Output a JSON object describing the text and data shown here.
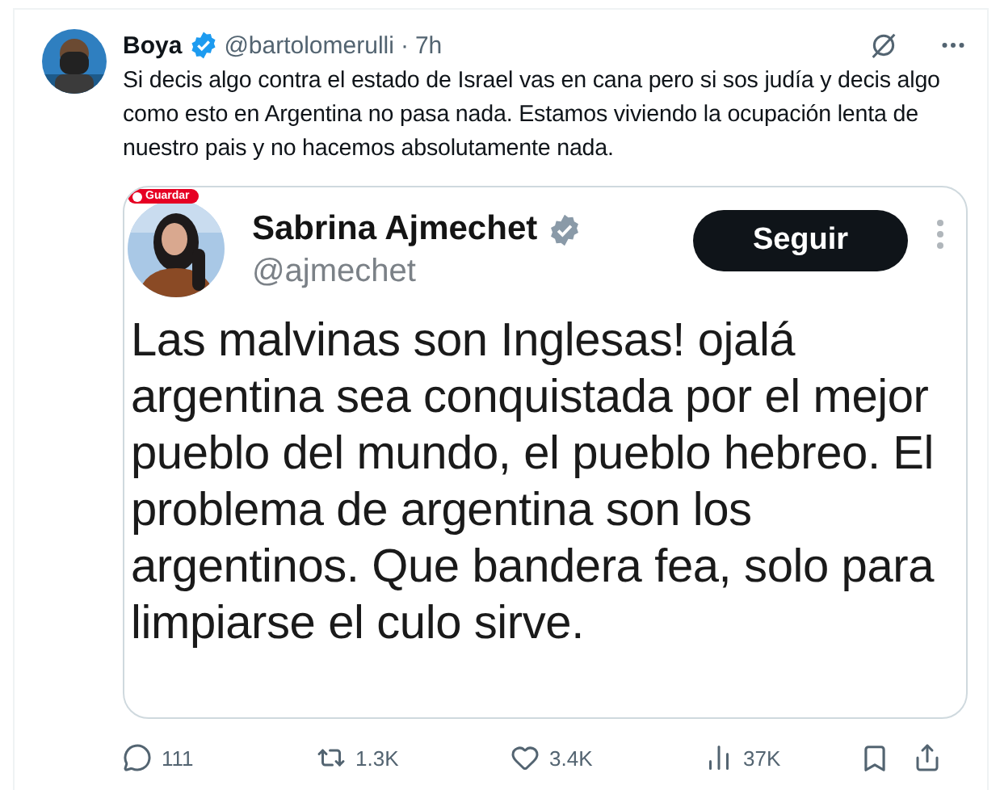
{
  "tweet": {
    "author": {
      "name": "Boya",
      "handle": "@bartolomerulli",
      "verified": true
    },
    "separator": "·",
    "time": "7h",
    "text": "Si decis algo contra el estado de Israel vas en cana pero si sos judía y decis algo como esto en Argentina no pasa nada. Estamos viviendo la ocupación lenta de nuestro pais y no hacemos absolutamente nada.",
    "embedded_screenshot": {
      "badge": "Guardar",
      "author": {
        "name": "Sabrina Ajmechet",
        "handle": "@ajmechet",
        "verified": true
      },
      "follow_button": "Seguir",
      "text": "Las malvinas son Inglesas! ojalá argentina sea conquistada por el mejor pueblo del mundo, el pueblo hebreo. El problema de argentina son los argentinos. Que bandera fea, solo para limpiarse el culo sirve."
    },
    "actions": [
      {
        "kind": "reply",
        "count": "111"
      },
      {
        "kind": "repost",
        "count": "1.3K"
      },
      {
        "kind": "like",
        "count": "3.4K"
      },
      {
        "kind": "views",
        "count": "37K"
      }
    ]
  }
}
